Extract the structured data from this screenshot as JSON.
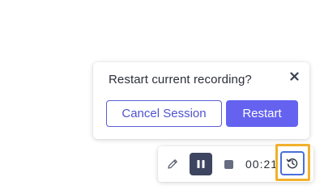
{
  "dialog": {
    "title": "Restart current recording?",
    "cancel_label": "Cancel Session",
    "restart_label": "Restart",
    "close_icon": "close-icon"
  },
  "toolbar": {
    "timer": "00:21",
    "icons": [
      "pencil-icon",
      "pause-icon",
      "stop-icon",
      "history-icon"
    ]
  },
  "colors": {
    "accent": "#6462ef",
    "accent_border": "#5b5fd6",
    "pause_bg": "#3e4560",
    "highlight": "#f1b12b",
    "history_border": "#4a6fd8"
  }
}
